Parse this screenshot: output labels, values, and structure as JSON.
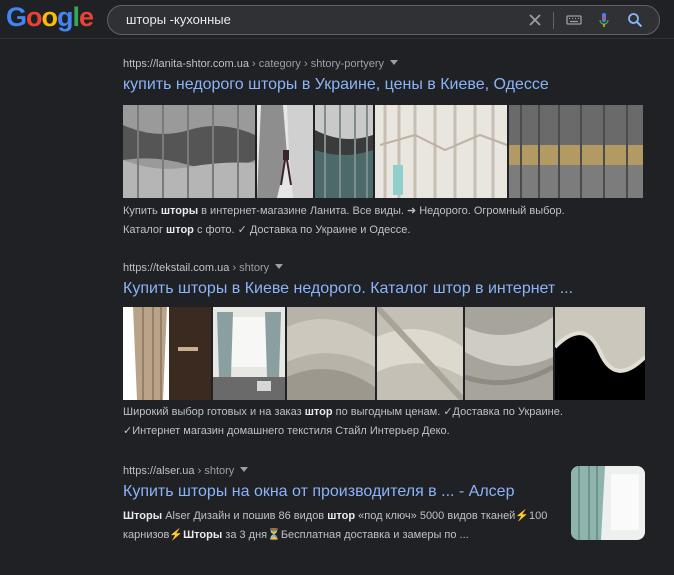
{
  "logo": {
    "letters": [
      "G",
      "o",
      "o",
      "g",
      "l",
      "e"
    ],
    "colors": [
      "#4285f4",
      "#ea4335",
      "#fbbc05",
      "#4285f4",
      "#34a853",
      "#ea4335"
    ]
  },
  "search": {
    "query": "шторы -кухонные"
  },
  "icons": {
    "clear": "close-icon",
    "keyboard": "keyboard-icon",
    "mic": "mic-icon",
    "search": "search-icon"
  },
  "results": [
    {
      "domain": "https://lanita-shtor.com.ua",
      "breadcrumb": " › category › shtory-portyery",
      "title": "купить недорого шторы в Украине, цены в Киеве, Одессе",
      "snippet_parts": [
        {
          "t": "Купить ",
          "b": false
        },
        {
          "t": "шторы",
          "b": true
        },
        {
          "t": " в интернет-магазине Ланита. Все виды. ➜ Недорого. Огромный выбор.",
          "b": false
        }
      ],
      "snippet_parts_2": [
        {
          "t": "Каталог ",
          "b": false
        },
        {
          "t": "штор",
          "b": true
        },
        {
          "t": " с фото. ✓ Доставка по Украине и Одессе.",
          "b": false
        }
      ]
    },
    {
      "domain": "https://tekstail.com.ua",
      "breadcrumb": " › shtory",
      "title": "Купить шторы в Киеве недорого. Каталог штор в интернет ...",
      "snippet_parts": [
        {
          "t": "Широкий выбор готовых и на заказ ",
          "b": false
        },
        {
          "t": "штор",
          "b": true
        },
        {
          "t": " по выгодным ценам. ✓Доставка по Украине.",
          "b": false
        }
      ],
      "snippet_parts_2": [
        {
          "t": "✓Интернет магазин домашнего текстиля Стайл Интерьер Деко.",
          "b": false
        }
      ]
    },
    {
      "domain": "https://alser.ua",
      "breadcrumb": " › shtory",
      "title": "Купить шторы на окна от производителя в ... - Алсер",
      "snippet_parts": [
        {
          "t": "Шторы",
          "b": true
        },
        {
          "t": " Alser Дизайн и пошив 86 видов ",
          "b": false
        },
        {
          "t": "штор",
          "b": true
        },
        {
          "t": " «под ключ» 5000 видов тканей⚡100",
          "b": false
        }
      ],
      "snippet_parts_2": [
        {
          "t": "карнизов⚡",
          "b": false
        },
        {
          "t": "Шторы",
          "b": true
        },
        {
          "t": " за 3 дня⏳Бесплатная доставка и замеры по ...",
          "b": false
        }
      ]
    }
  ]
}
